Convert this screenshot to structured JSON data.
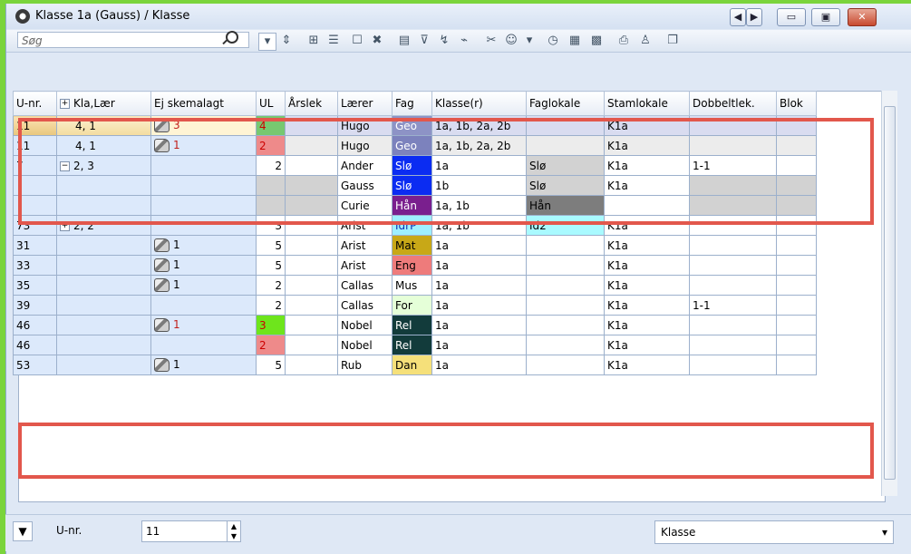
{
  "window": {
    "title": "Klasse 1a (Gauss) / Klasse"
  },
  "toolbar": {
    "search_placeholder": "Søg"
  },
  "columns": [
    "U-nr.",
    "Kla,Lær",
    "Ej skemalagt",
    "UL",
    "Årslek",
    "Lærer",
    "Fag",
    "Klasse(r)",
    "Faglokale",
    "Stamlokale",
    "Dobbeltlek.",
    "Blok"
  ],
  "rows": [
    {
      "unr": "11",
      "kla": "4, 1",
      "ej": "3",
      "ul": "4",
      "aarslek": "",
      "laerer": "Hugo",
      "fag": "Geo",
      "klasse": "1a, 1b, 2a, 2b",
      "faglokale": "",
      "stamlokale": "K1a",
      "dobbelt": "",
      "blok": ""
    },
    {
      "unr": "11",
      "kla": "4, 1",
      "ej": "1",
      "ul": "2",
      "aarslek": "",
      "laerer": "Hugo",
      "fag": "Geo",
      "klasse": "1a, 1b, 2a, 2b",
      "faglokale": "",
      "stamlokale": "K1a",
      "dobbelt": "",
      "blok": ""
    },
    {
      "unr": "7",
      "kla": "2, 3",
      "ej": "",
      "ul": "2",
      "aarslek": "",
      "laerer": "Ander",
      "fag": "Slø",
      "klasse": "1a",
      "faglokale": "Slø",
      "stamlokale": "K1a",
      "dobbelt": "1-1",
      "blok": ""
    },
    {
      "unr": "",
      "kla": "",
      "ej": "",
      "ul": "",
      "aarslek": "",
      "laerer": "Gauss",
      "fag": "Slø",
      "klasse": "1b",
      "faglokale": "Slø",
      "stamlokale": "K1a",
      "dobbelt": "",
      "blok": ""
    },
    {
      "unr": "",
      "kla": "",
      "ej": "",
      "ul": "",
      "aarslek": "",
      "laerer": "Curie",
      "fag": "Hån",
      "klasse": "1a, 1b",
      "faglokale": "Hån",
      "stamlokale": "",
      "dobbelt": "",
      "blok": ""
    },
    {
      "unr": "73",
      "kla": "2, 2",
      "ej": "",
      "ul": "3",
      "aarslek": "",
      "laerer": "Arist",
      "fag": "IdrP",
      "klasse": "1a, 1b",
      "faglokale": "Id2",
      "stamlokale": "K1a",
      "dobbelt": "",
      "blok": ""
    },
    {
      "unr": "31",
      "kla": "",
      "ej": "1",
      "ul": "5",
      "aarslek": "",
      "laerer": "Arist",
      "fag": "Mat",
      "klasse": "1a",
      "faglokale": "",
      "stamlokale": "K1a",
      "dobbelt": "",
      "blok": ""
    },
    {
      "unr": "33",
      "kla": "",
      "ej": "1",
      "ul": "5",
      "aarslek": "",
      "laerer": "Arist",
      "fag": "Eng",
      "klasse": "1a",
      "faglokale": "",
      "stamlokale": "K1a",
      "dobbelt": "",
      "blok": ""
    },
    {
      "unr": "35",
      "kla": "",
      "ej": "1",
      "ul": "2",
      "aarslek": "",
      "laerer": "Callas",
      "fag": "Mus",
      "klasse": "1a",
      "faglokale": "",
      "stamlokale": "K1a",
      "dobbelt": "",
      "blok": ""
    },
    {
      "unr": "39",
      "kla": "",
      "ej": "",
      "ul": "2",
      "aarslek": "",
      "laerer": "Callas",
      "fag": "For",
      "klasse": "1a",
      "faglokale": "",
      "stamlokale": "K1a",
      "dobbelt": "1-1",
      "blok": ""
    },
    {
      "unr": "46",
      "kla": "",
      "ej": "1",
      "ul": "3",
      "aarslek": "",
      "laerer": "Nobel",
      "fag": "Rel",
      "klasse": "1a",
      "faglokale": "",
      "stamlokale": "K1a",
      "dobbelt": "",
      "blok": ""
    },
    {
      "unr": "46",
      "kla": "",
      "ej": "",
      "ul": "2",
      "aarslek": "",
      "laerer": "Nobel",
      "fag": "Rel",
      "klasse": "1a",
      "faglokale": "",
      "stamlokale": "K1a",
      "dobbelt": "",
      "blok": ""
    },
    {
      "unr": "53",
      "kla": "",
      "ej": "1",
      "ul": "5",
      "aarslek": "",
      "laerer": "Rub",
      "fag": "Dan",
      "klasse": "1a",
      "faglokale": "",
      "stamlokale": "K1a",
      "dobbelt": "",
      "blok": ""
    }
  ],
  "bottom": {
    "unr_label": "U-nr.",
    "unr_value": "11",
    "view_select": "Klasse"
  }
}
